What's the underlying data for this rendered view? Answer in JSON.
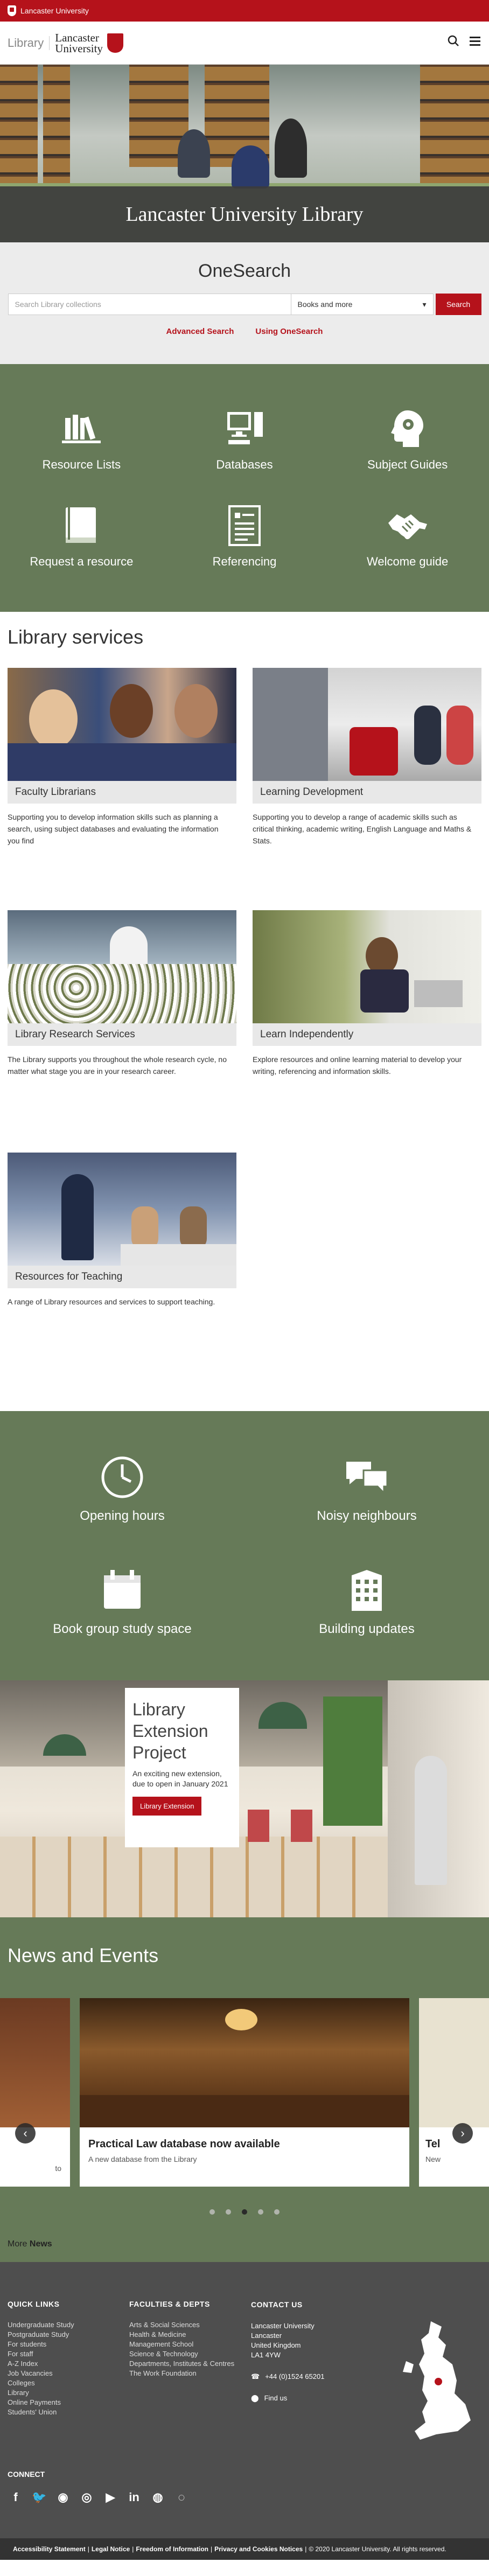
{
  "topbar": {
    "label": "Lancaster University"
  },
  "header": {
    "library_label": "Library",
    "logo_line1": "Lancaster",
    "logo_line2": "University"
  },
  "hero": {
    "title": "Lancaster University Library"
  },
  "onesearch": {
    "title": "OneSearch",
    "placeholder": "Search Library collections",
    "select_value": "Books and more",
    "button": "Search",
    "links": [
      "Advanced Search",
      "Using OneSearch"
    ]
  },
  "quick_tiles": [
    {
      "label": "Resource Lists",
      "icon": "books-icon"
    },
    {
      "label": "Databases",
      "icon": "computer-icon"
    },
    {
      "label": "Subject Guides",
      "icon": "head-icon"
    },
    {
      "label": "Request a resource",
      "icon": "book-icon"
    },
    {
      "label": "Referencing",
      "icon": "document-icon"
    },
    {
      "label": "Welcome guide",
      "icon": "handshake-icon"
    }
  ],
  "services": {
    "title": "Library services",
    "cards": [
      {
        "caption": "Faculty Librarians",
        "text": "Supporting you to develop information skills such as planning a search, using subject databases and evaluating the information you find"
      },
      {
        "caption": "Learning Development",
        "text": "Supporting you to develop a range of academic skills such as critical thinking, academic writing, English Language and Maths & Stats."
      },
      {
        "caption": "Library Research Services",
        "text": "The Library supports you throughout the whole research cycle, no matter what stage you are in your research career."
      },
      {
        "caption": "Learn Independently",
        "text": "Explore resources and online learning material to develop your writing, referencing and information skills."
      },
      {
        "caption": "Resources for Teaching",
        "text": "A range of Library resources and services to support teaching."
      }
    ]
  },
  "info_tiles": [
    {
      "label": "Opening hours",
      "icon": "clock-icon"
    },
    {
      "label": "Noisy neighbours",
      "icon": "chat-bubbles-icon"
    },
    {
      "label": "Book group study space",
      "icon": "calendar-icon"
    },
    {
      "label": "Building updates",
      "icon": "building-icon"
    }
  ],
  "extension": {
    "title": "Library Extension Project",
    "text": "An exciting new extension, due to open in January 2021",
    "button": "Library Extension"
  },
  "news": {
    "title": "News and Events",
    "left_fragment": "to",
    "featured": {
      "title": "Practical Law database now available",
      "text": "A new database from the Library"
    },
    "right_fragment_title": "Tel",
    "right_fragment_text": "New",
    "more_prefix": "More",
    "more_bold": "News"
  },
  "footer": {
    "quick_links_title": "QUICK LINKS",
    "quick_links": [
      "Undergraduate Study",
      "Postgraduate Study",
      "For students",
      "For staff",
      "A-Z Index",
      "Job Vacancies",
      "Colleges",
      "Library",
      "Online Payments",
      "Students' Union"
    ],
    "faculties_title": "FACULTIES & DEPTS",
    "faculties": [
      "Arts & Social Sciences",
      "Health & Medicine",
      "Management School",
      "Science & Technology",
      "Departments, Institutes & Centres",
      "The Work Foundation"
    ],
    "contact_title": "CONTACT US",
    "address": [
      "Lancaster University",
      "Lancaster",
      "United Kingdom",
      "LA1 4YW"
    ],
    "phone": "+44 (0)1524 65201",
    "find_us": "Find us",
    "connect_title": "CONNECT"
  },
  "legal": {
    "items": [
      "Accessibility Statement",
      "Legal Notice",
      "Freedom of Information",
      "Privacy and Cookies Notices"
    ],
    "copyright": "© 2020 Lancaster University. All rights reserved."
  },
  "colors": {
    "brand_red": "#b5121b",
    "green": "#667a58",
    "footer": "#4e4e4e"
  }
}
